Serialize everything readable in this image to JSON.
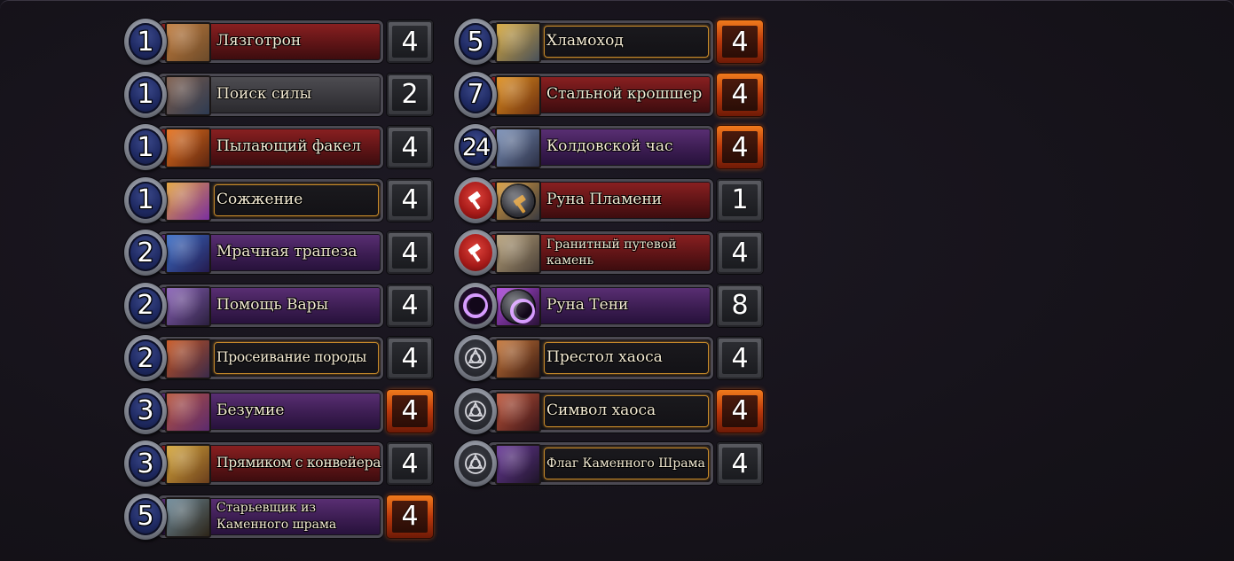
{
  "left_column": [
    {
      "cost": "1",
      "name": "Лязготрон",
      "count": "4",
      "bar": "red",
      "golden_count": false,
      "art": [
        "#c07b3c",
        "#6b4a2a"
      ],
      "lines": 1
    },
    {
      "cost": "1",
      "name": "Поиск силы",
      "count": "2",
      "bar": "grey",
      "golden_count": false,
      "art": [
        "#7c5b4a",
        "#2d3b52"
      ],
      "lines": 1
    },
    {
      "cost": "1",
      "name": "Пылающий факел",
      "count": "4",
      "bar": "red",
      "golden_count": false,
      "art": [
        "#e8721c",
        "#5a2410"
      ],
      "lines": 1
    },
    {
      "cost": "1",
      "name": "Сожжение",
      "count": "4",
      "bar": "black",
      "legendary": true,
      "golden_count": false,
      "art": [
        "#e3a23a",
        "#7a2ea0"
      ],
      "lines": 1
    },
    {
      "cost": "2",
      "name": "Мрачная трапеза",
      "count": "4",
      "bar": "purple",
      "golden_count": false,
      "art": [
        "#3a6ec8",
        "#241a4e"
      ],
      "lines": 1
    },
    {
      "cost": "2",
      "name": "Помощь Вары",
      "count": "4",
      "bar": "purple",
      "golden_count": false,
      "art": [
        "#8a62b8",
        "#2a1f3e"
      ],
      "lines": 1
    },
    {
      "cost": "2",
      "name": "Просеивание породы",
      "count": "4",
      "bar": "black",
      "legendary": true,
      "golden_count": false,
      "art": [
        "#c8541e",
        "#3a2a4a"
      ],
      "lines": 1,
      "narrow": true
    },
    {
      "cost": "3",
      "name": "Безумие",
      "count": "4",
      "bar": "purple",
      "golden_count": true,
      "art": [
        "#b8543a",
        "#5b2a6e"
      ],
      "lines": 1
    },
    {
      "cost": "3",
      "name": "Прямиком с конвейера",
      "count": "4",
      "bar": "red",
      "golden_count": false,
      "art": [
        "#d7a83a",
        "#6a3e1c"
      ],
      "lines": 1,
      "narrow": true
    },
    {
      "cost": "5",
      "name": "Старьевщик из Каменного шрама",
      "count": "4",
      "bar": "purple",
      "golden_count": true,
      "art": [
        "#6e8a9a",
        "#2c2418"
      ],
      "lines": 2
    }
  ],
  "right_column": [
    {
      "cost": "5",
      "name": "Хламоход",
      "count": "4",
      "bar": "black",
      "legendary": true,
      "golden_count": true,
      "art": [
        "#d8a83a",
        "#48505a"
      ],
      "lines": 1
    },
    {
      "cost": "7",
      "name": "Стальной крошшер",
      "count": "4",
      "bar": "red",
      "golden_count": true,
      "art": [
        "#e0901e",
        "#6a2e10"
      ],
      "lines": 1
    },
    {
      "cost": "24",
      "name": "Колдовской час",
      "count": "4",
      "bar": "purple",
      "golden_count": true,
      "art": [
        "#7a90b8",
        "#2a2e44"
      ],
      "lines": 1
    },
    {
      "icon": "blood-rune-icon",
      "rune": "blood",
      "name": "Руна Пламени",
      "count": "1",
      "bar": "red",
      "golden_count": false,
      "art": [
        "#d89a3a",
        "#3a3a40"
      ],
      "spell": true,
      "lines": 1
    },
    {
      "icon": "blood-rune-icon",
      "rune": "blood",
      "name": "Гранитный путевой камень",
      "count": "4",
      "bar": "red",
      "golden_count": false,
      "art": [
        "#b8a27a",
        "#4a4038"
      ],
      "lines": 2
    },
    {
      "icon": "shadow-rune-icon",
      "rune": "shadow",
      "name": "Руна Тени",
      "count": "8",
      "bar": "purple",
      "golden_count": false,
      "art": [
        "#b04ae0",
        "#2a1238"
      ],
      "spell": true,
      "lines": 1
    },
    {
      "icon": "neutral-class-icon",
      "rune": "neutral",
      "name": "Престол хаоса",
      "count": "4",
      "bar": "black",
      "legendary": true,
      "golden_count": false,
      "art": [
        "#c8783a",
        "#3a1a12"
      ],
      "lines": 1
    },
    {
      "icon": "neutral-class-icon",
      "rune": "neutral",
      "name": "Символ хаоса",
      "count": "4",
      "bar": "black",
      "legendary": true,
      "golden_count": true,
      "art": [
        "#c0563a",
        "#3a1418"
      ],
      "lines": 1
    },
    {
      "icon": "neutral-class-icon",
      "rune": "neutral",
      "name": "Флаг Каменного Шрама",
      "count": "4",
      "bar": "black",
      "legendary": true,
      "golden_count": false,
      "art": [
        "#6a3a9a",
        "#1e1428"
      ],
      "lines": 2
    }
  ]
}
